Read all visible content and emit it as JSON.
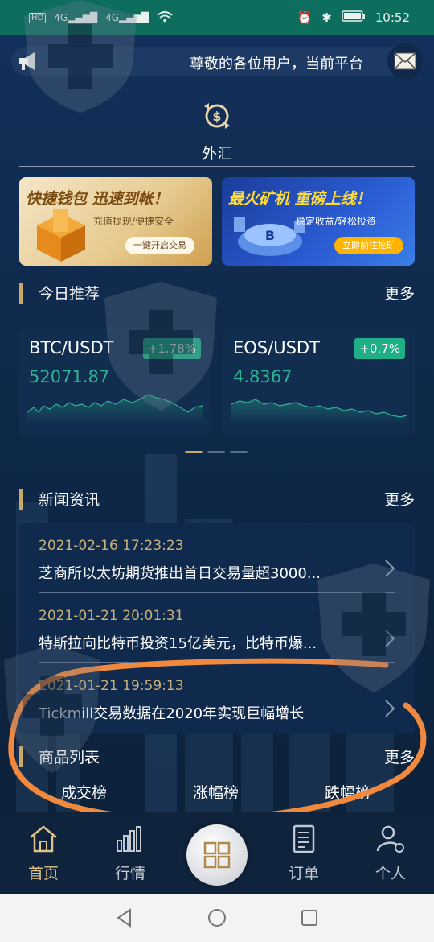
{
  "status_bar": {
    "left_icons": [
      "hd-icon",
      "signal-4g-icon",
      "signal-4g-icon",
      "wifi-icon"
    ],
    "time": "10:52"
  },
  "notice": {
    "text": "尊敬的各位用户，当前平台"
  },
  "category": {
    "label": "外汇"
  },
  "banners": [
    {
      "headline": "快捷钱包 迅速到帐！",
      "subtitle": "充值提现/便捷安全",
      "button": "一键开启交易"
    },
    {
      "headline": "最火矿机 重磅上线！",
      "subtitle": "稳定收益/轻松投资",
      "button": "立即前往挖矿"
    }
  ],
  "recommend": {
    "title": "今日推荐",
    "more": "更多",
    "cards": [
      {
        "pair": "BTC/USDT",
        "change": "+1.78%",
        "price": "52071.87"
      },
      {
        "pair": "EOS/USDT",
        "change": "+0.7%",
        "price": "4.8367"
      }
    ]
  },
  "news": {
    "title": "新闻资讯",
    "more": "更多",
    "items": [
      {
        "date": "2021-02-16 17:23:23",
        "title": "芝商所以太坊期货推出首日交易量超3000..."
      },
      {
        "date": "2021-01-21 20:01:31",
        "title": "特斯拉向比特币投资15亿美元，比特币爆..."
      },
      {
        "date": "2021-01-21 19:59:13",
        "title": "Tickmill交易数据在2020年实现巨幅增长"
      }
    ]
  },
  "products": {
    "title": "商品列表",
    "more": "更多",
    "tabs": [
      "成交榜",
      "涨幅榜",
      "跌幅榜"
    ]
  },
  "tabbar": [
    {
      "label": "首页",
      "icon": "home-icon",
      "active": true
    },
    {
      "label": "行情",
      "icon": "market-chart-icon",
      "active": false
    },
    {
      "label": "订单",
      "icon": "order-document-icon",
      "active": false
    },
    {
      "label": "个人",
      "icon": "user-settings-icon",
      "active": false
    }
  ],
  "colors": {
    "accent_gold": "#c8a96a",
    "up_green": "#1fae86",
    "price_green": "#2fb393",
    "status_bar": "#0d6e5e",
    "annotation_orange": "#f0883e"
  }
}
